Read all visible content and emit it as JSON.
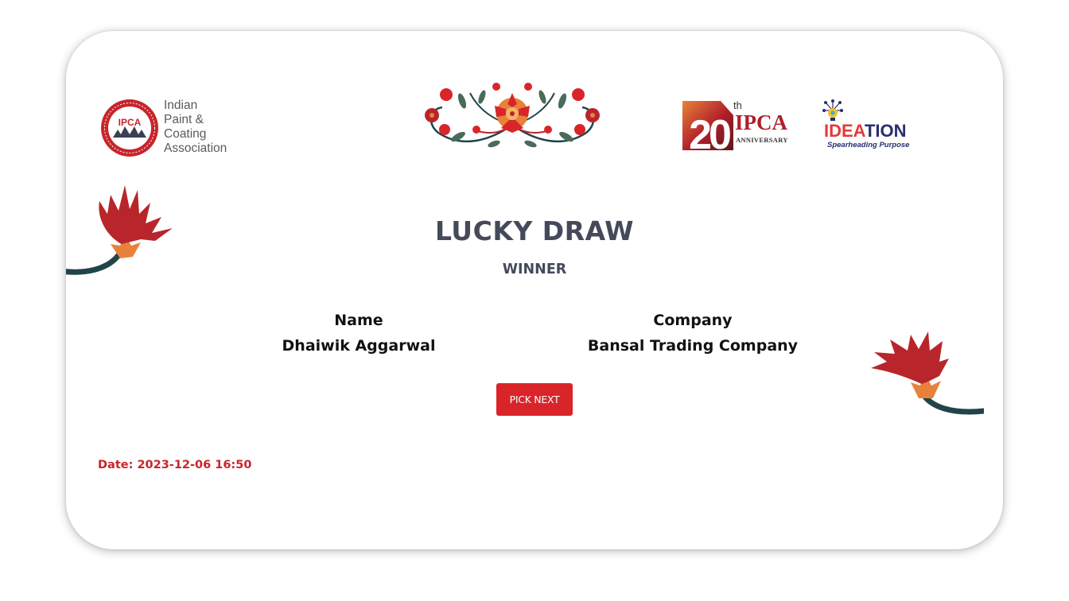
{
  "logos": {
    "ipca": {
      "emblem_text": "IPCA",
      "ring_text": "INDIAN PAINT & COATING",
      "lines": [
        "Indian",
        "Paint &",
        "Coating",
        "Association"
      ]
    },
    "anniversary": {
      "number": "20",
      "suffix": "th",
      "name": "IPCA",
      "subtitle": "ANNIVERSARY"
    },
    "ideation": {
      "word_red": "IDEA",
      "word_blue": "TION",
      "tagline": "Spearheading Purpose"
    }
  },
  "draw": {
    "title": "LUCKY DRAW",
    "subtitle": "WINNER",
    "name_label": "Name",
    "name_value": "Dhaiwik Aggarwal",
    "company_label": "Company",
    "company_value": "Bansal Trading Company",
    "button_label": "PICK NEXT",
    "date_label": "Date:",
    "date_value": "2023-12-06 16:50"
  },
  "colors": {
    "accent_red": "#d9252a",
    "heading_gray": "#454a5a",
    "date_red": "#c8252a",
    "flower_red": "#b8262b",
    "flower_orange": "#e8823a",
    "stem_teal": "#21444a"
  }
}
